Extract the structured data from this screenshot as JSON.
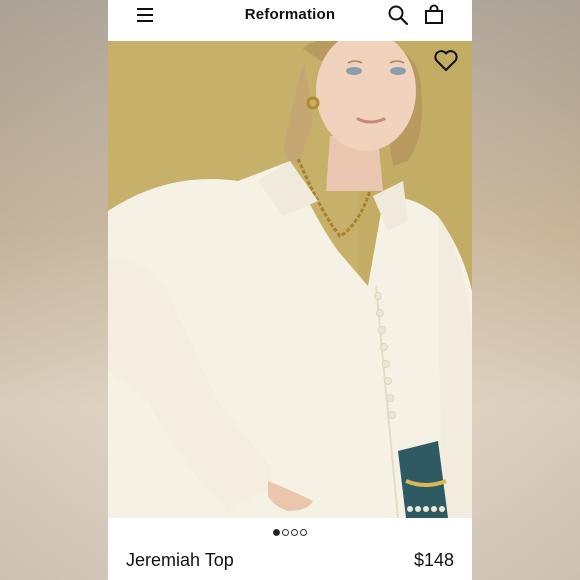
{
  "header": {
    "brand": "Reformation",
    "icons": {
      "menu": "hamburger-menu-icon",
      "search": "search-icon",
      "bag": "shopping-bag-icon"
    }
  },
  "hero": {
    "favorite_icon": "heart-icon",
    "carousel": {
      "total": 4,
      "active": 1
    }
  },
  "product": {
    "name": "Jeremiah Top",
    "price": "$148"
  },
  "colors": {
    "backdrop": "#c5b59e",
    "hero_bg": "#c4ad67",
    "blouse": "#f6f2e6",
    "text": "#111111"
  }
}
